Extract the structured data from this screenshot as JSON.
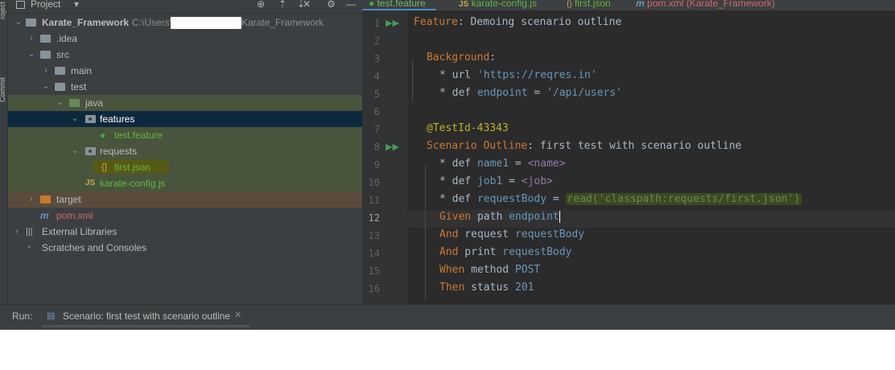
{
  "project_panel": {
    "title": "Project",
    "tree": [
      {
        "label": "Karate_Framework",
        "path": "C:\\Users\\",
        "path_tail": "Karate_Framework"
      },
      {
        "label": ".idea"
      },
      {
        "label": "src"
      },
      {
        "label": "main"
      },
      {
        "label": "test"
      },
      {
        "label": "java"
      },
      {
        "label": "features"
      },
      {
        "label": "test.feature"
      },
      {
        "label": "requests"
      },
      {
        "label": "first.json"
      },
      {
        "label": "karate-config.js"
      },
      {
        "label": "target"
      },
      {
        "label": "pom.xml"
      },
      {
        "label": "External Libraries"
      },
      {
        "label": "Scratches and Consoles"
      }
    ]
  },
  "tabs": [
    {
      "label": "test.feature"
    },
    {
      "label": "karate-config.js"
    },
    {
      "label": "first.json"
    },
    {
      "label": "pom.xml (Karate_Framework)"
    }
  ],
  "editor": {
    "current_line": 12,
    "lines": [
      {
        "n": "1"
      },
      {
        "n": "2"
      },
      {
        "n": "3"
      },
      {
        "n": "4"
      },
      {
        "n": "5"
      },
      {
        "n": "6"
      },
      {
        "n": "7"
      },
      {
        "n": "8"
      },
      {
        "n": "9"
      },
      {
        "n": "10"
      },
      {
        "n": "11"
      },
      {
        "n": "12"
      },
      {
        "n": "13"
      },
      {
        "n": "14"
      },
      {
        "n": "15"
      },
      {
        "n": "16"
      }
    ],
    "code": {
      "l1_kw": "Feature",
      "l1_rest": ": Demoing scenario outline",
      "l3_kw": "Background",
      "l3_rest": ":",
      "l4_a": "* url ",
      "l4_b": "'https://reqres.in'",
      "l5_a": "* def ",
      "l5_b": "endpoint",
      "l5_c": " = ",
      "l5_d": "'/api/users'",
      "l7": "@TestId-43343",
      "l8_kw": "Scenario Outline",
      "l8_rest": ": first test with scenario outline",
      "l9_a": "* def ",
      "l9_b": "name1",
      "l9_c": " = ",
      "l9_d": "<name>",
      "l10_a": "* def ",
      "l10_b": "job1",
      "l10_c": " = ",
      "l10_d": "<job>",
      "l11_a": "* def ",
      "l11_b": "requestBody",
      "l11_c": " = ",
      "l11_d": "read('classpath:requests/first.json')",
      "l12_a": "Given",
      "l12_b": " path ",
      "l12_c": "endpoint",
      "l13_a": "And",
      "l13_b": " request ",
      "l13_c": "requestBody",
      "l14_a": "And",
      "l14_b": " print ",
      "l14_c": "requestBody",
      "l15_a": "When",
      "l15_b": " method ",
      "l15_c": "POST",
      "l16_a": "Then",
      "l16_b": " status ",
      "l16_c": "201"
    }
  },
  "run_bar": {
    "label": "Run:",
    "tab": "Scenario: first test with scenario outline"
  },
  "colors": {
    "keyword": "#cc7832",
    "string": "#6a8759",
    "annotation": "#bbb529",
    "variable": "#6897bb",
    "placeholder": "#9876aa",
    "selection": "#0d293e",
    "highlight": "#4d5a3b"
  }
}
